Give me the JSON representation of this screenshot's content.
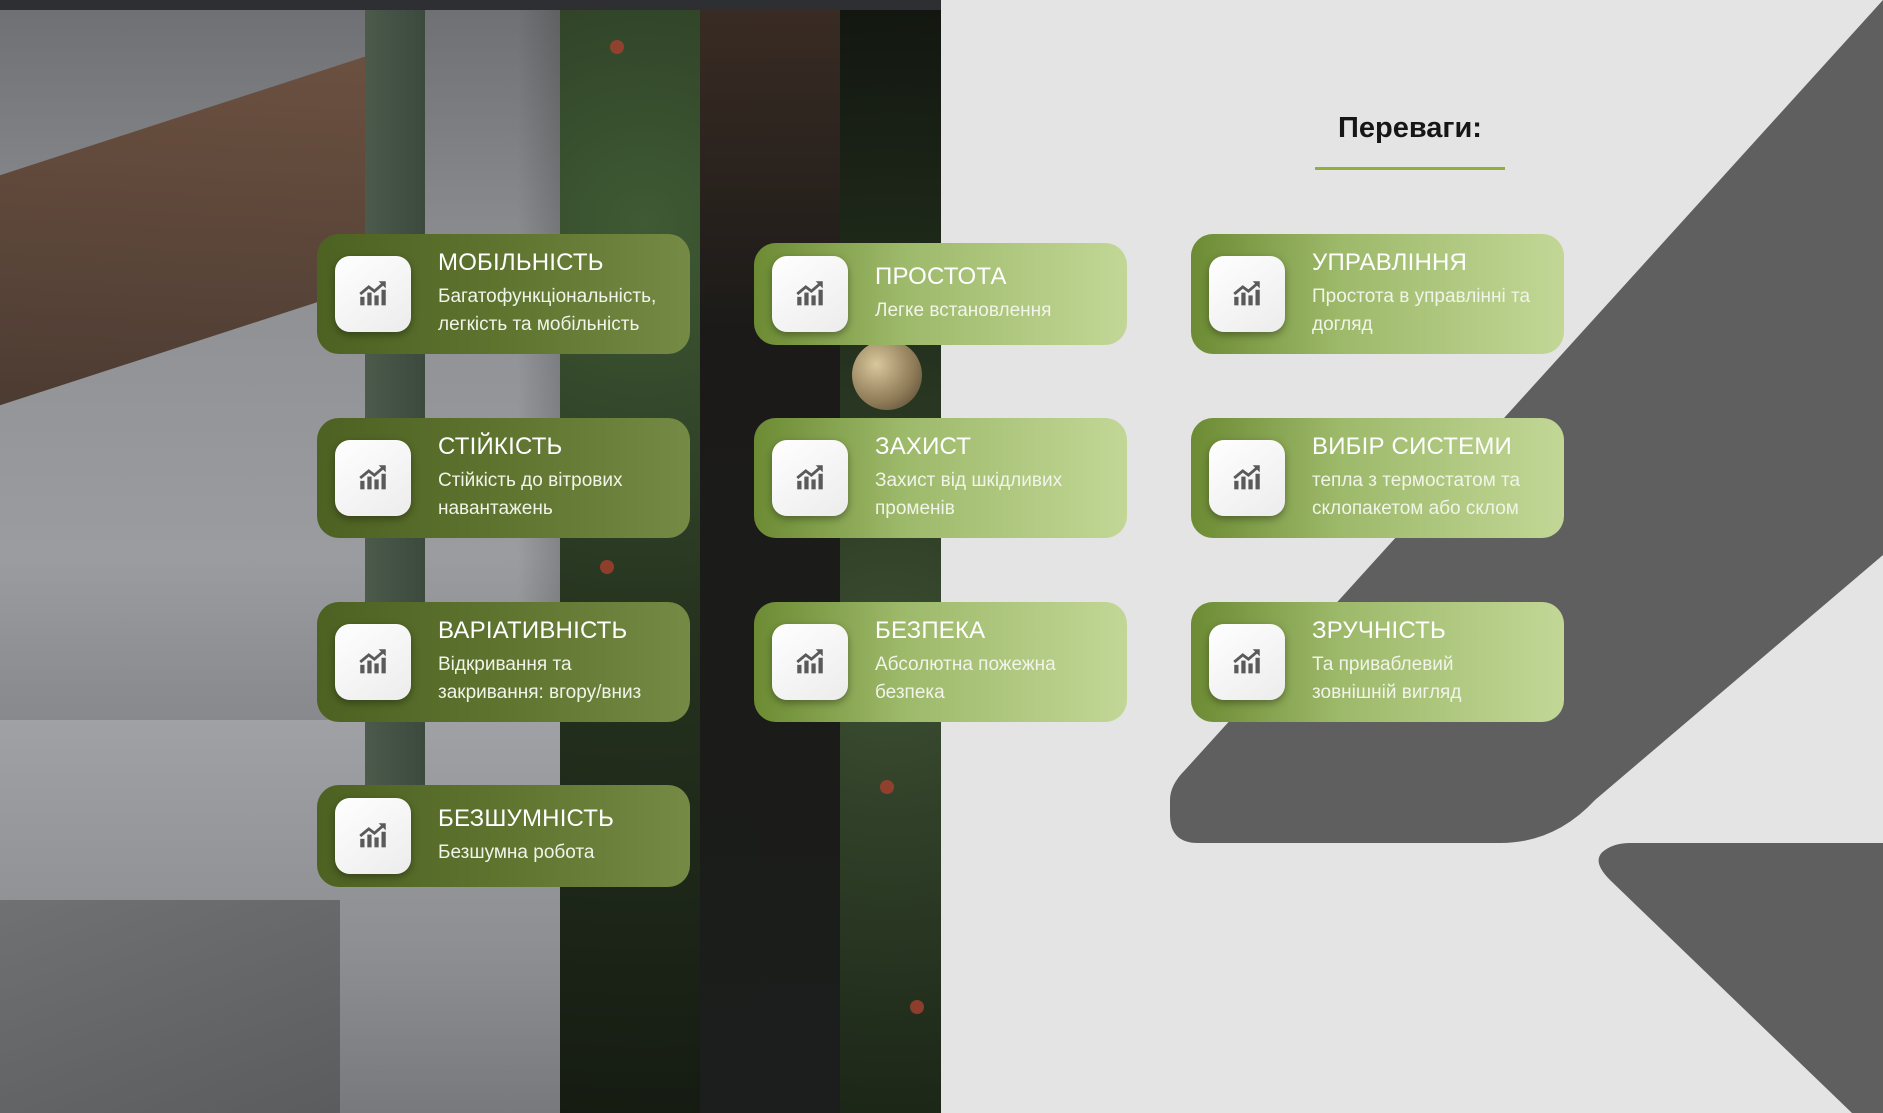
{
  "section": {
    "heading": "Переваги:"
  },
  "colors": {
    "accent_green": "#8fb13b",
    "card_dark": "#5e742f",
    "card_light": "#b5cd86",
    "deco_gray": "#5f5f5f",
    "background": "#e5e4e5"
  },
  "advantages": [
    {
      "icon": "trending-up-icon",
      "title": "МОБІЛЬНІСТЬ",
      "description": "Багатофункціональність,\nлегкість та мобільність"
    },
    {
      "icon": "trending-up-icon",
      "title": "ПРОСТОТА",
      "description": "Легке встановлення"
    },
    {
      "icon": "trending-up-icon",
      "title": "УПРАВЛІННЯ",
      "description": "Простота в управлінні та\nдогляд"
    },
    {
      "icon": "trending-up-icon",
      "title": "СТІЙКІСТЬ",
      "description": "Стійкість до вітрових\nнавантажень"
    },
    {
      "icon": "trending-up-icon",
      "title": "ЗАХИСТ",
      "description": "Захист від шкідливих\nпроменів"
    },
    {
      "icon": "trending-up-icon",
      "title": "ВИБІР СИСТЕМИ",
      "description": "тепла з термостатом та\nсклопакетом або склом"
    },
    {
      "icon": "trending-up-icon",
      "title": "ВАРІАТИВНІСТЬ",
      "description": "Відкривання та\nзакривання: вгору/вниз"
    },
    {
      "icon": "trending-up-icon",
      "title": "БЕЗПЕКА",
      "description": "Абсолютна пожежна\nбезпека"
    },
    {
      "icon": "trending-up-icon",
      "title": "ЗРУЧНІСТЬ",
      "description": "Та приваблевий\nзовнішній вигляд"
    },
    {
      "icon": "trending-up-icon",
      "title": "БЕЗШУМНІСТЬ",
      "description": "Безшумна робота"
    }
  ]
}
